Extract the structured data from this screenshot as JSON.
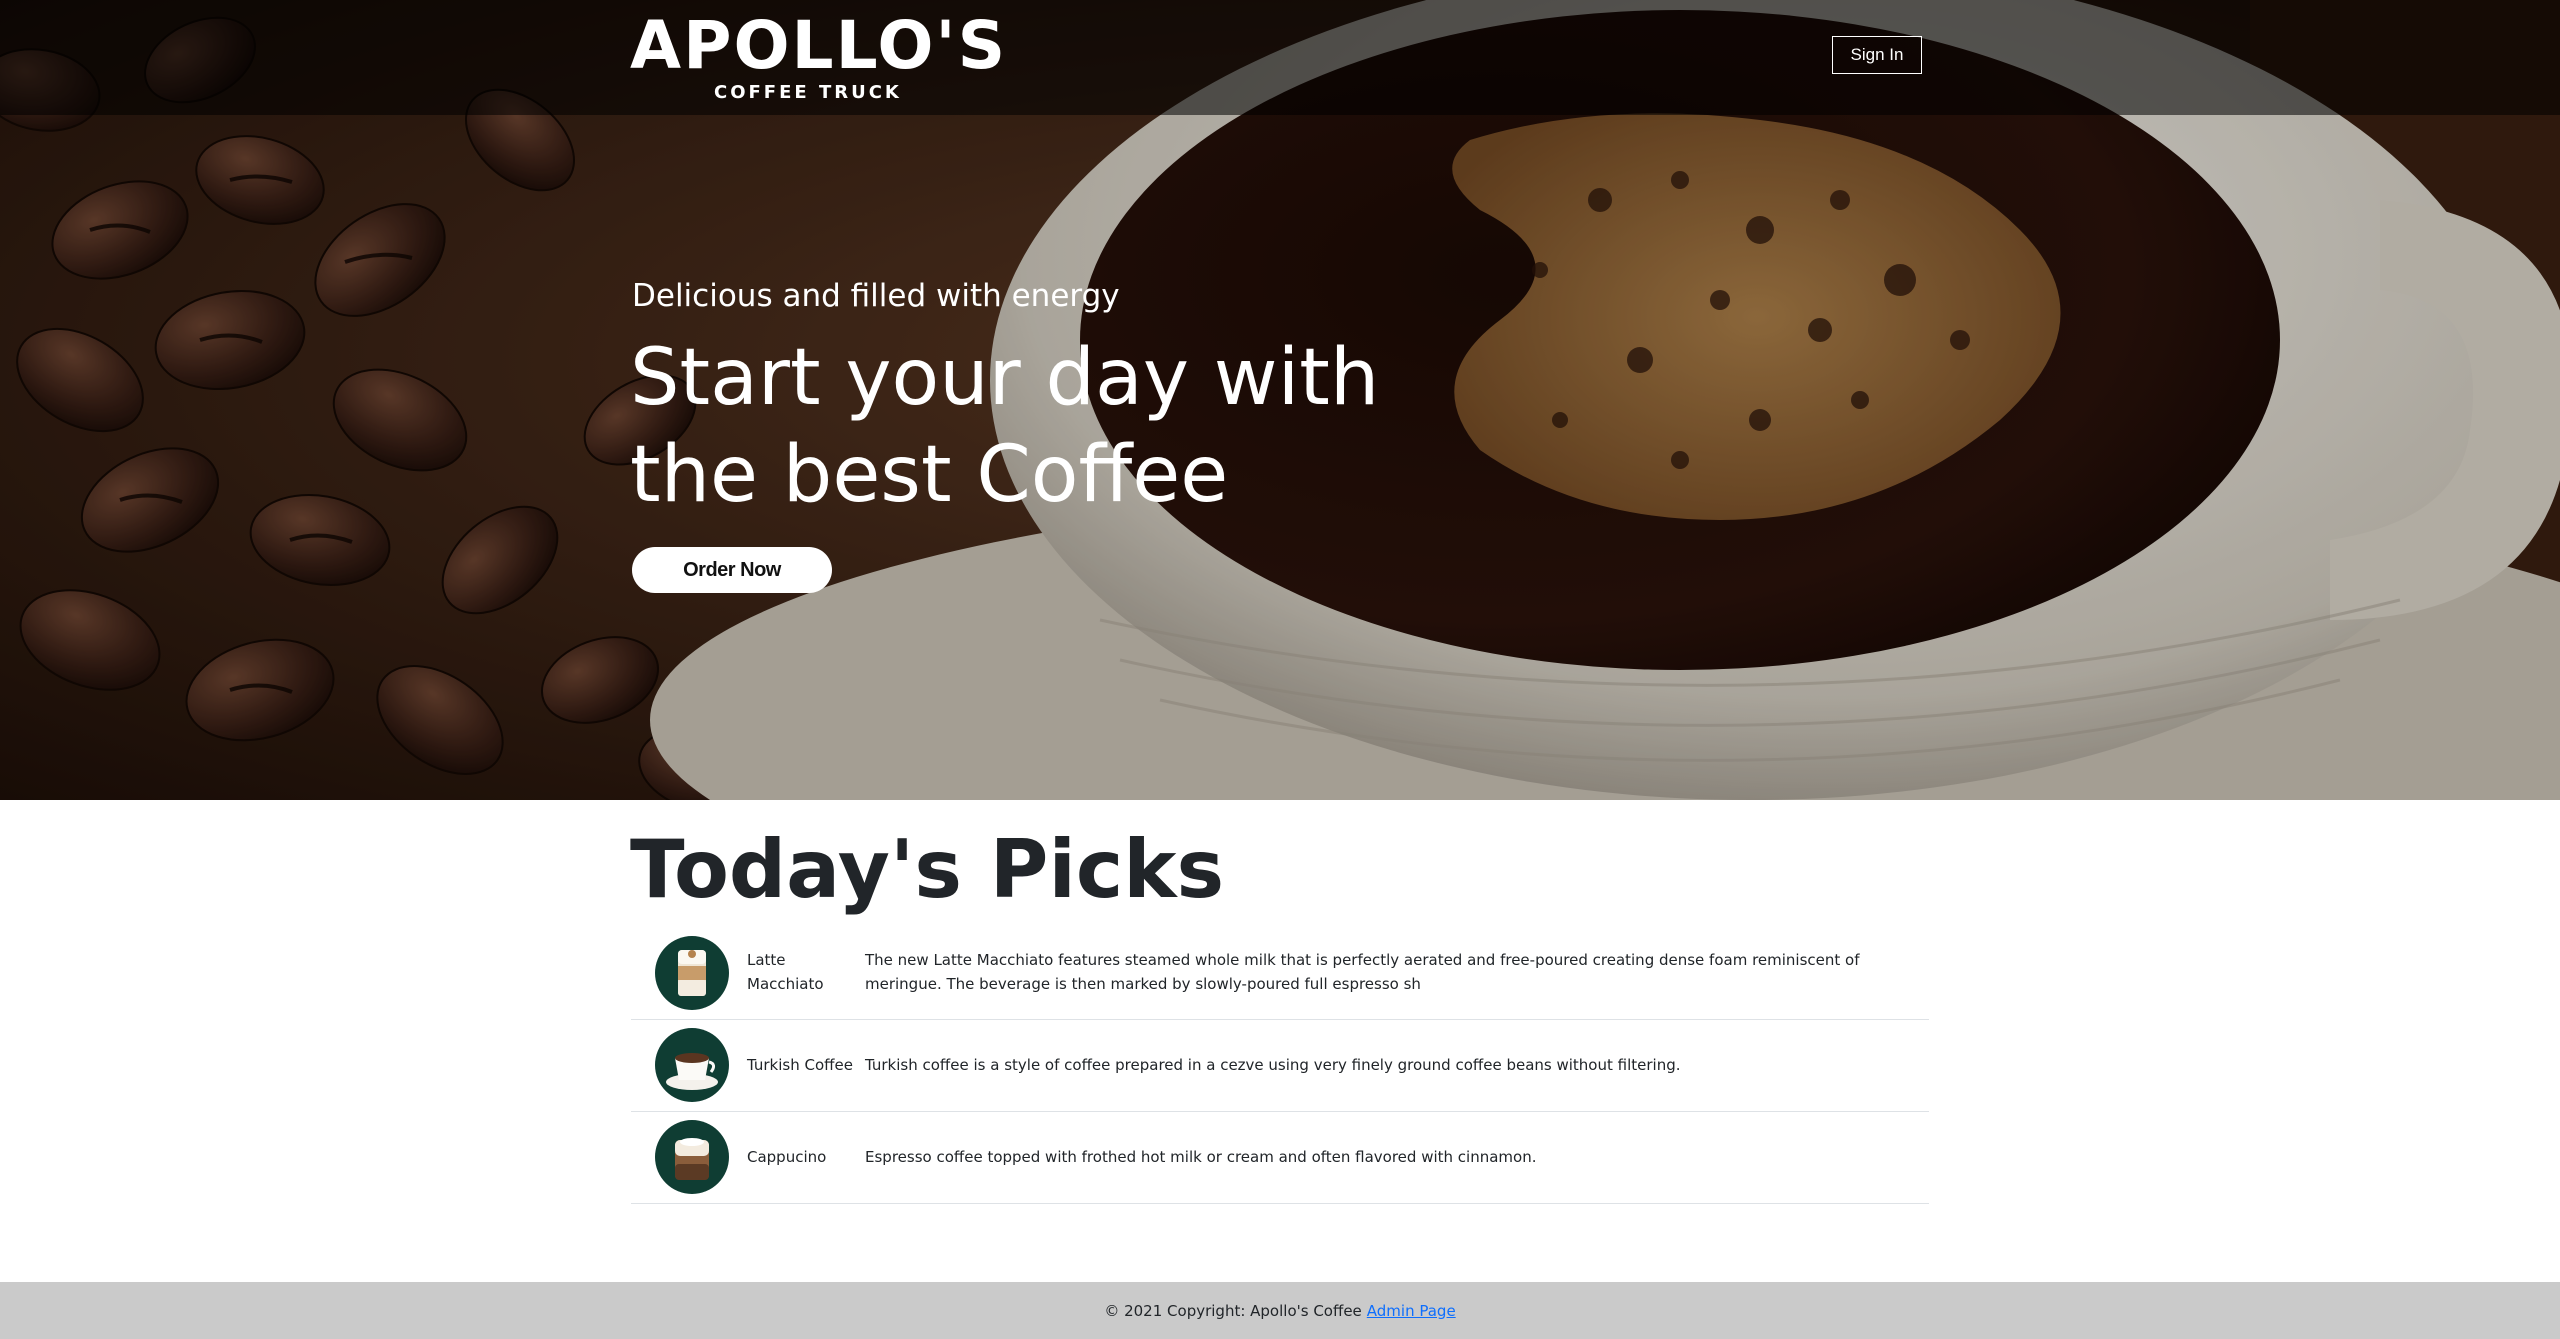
{
  "navbar": {
    "logo_text": "APOLLO'S",
    "logo_subtitle": "COFFEE TRUCK",
    "signin_label": "Sign In"
  },
  "hero": {
    "subtitle": "Delicious and filled with energy",
    "title_line1": "Start your day with",
    "title_line2": "the best Coffee",
    "order_button": "Order Now"
  },
  "picks": {
    "title": "Today's Picks",
    "items": [
      {
        "name": "Latte Macchiato",
        "description": "The new Latte Macchiato features steamed whole milk that is perfectly aerated and free-poured creating dense foam reminiscent of meringue. The beverage is then marked by slowly-poured full espresso sh",
        "icon": "latte-macchiato-icon"
      },
      {
        "name": "Turkish Coffee",
        "description": "Turkish coffee is a style of coffee prepared in a cezve using very finely ground coffee beans without filtering.",
        "icon": "turkish-coffee-icon"
      },
      {
        "name": "Cappucino",
        "description": "Espresso coffee topped with frothed hot milk or cream and often flavored with cinnamon.",
        "icon": "cappucino-icon"
      }
    ]
  },
  "footer": {
    "copyright": "© 2021 Copyright: Apollo's Coffee",
    "admin_link": "Admin Page"
  },
  "colors": {
    "thumb_bg": "#0f3d33",
    "footer_bg": "#cacaca",
    "link": "#0d6efd",
    "text": "#212529"
  }
}
